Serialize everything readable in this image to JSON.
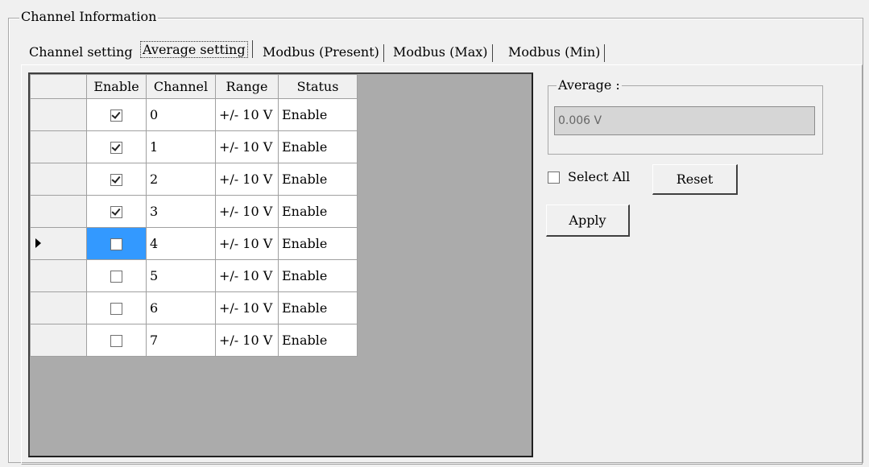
{
  "group_title": "Channel Information",
  "tabs": [
    {
      "label": "Channel setting",
      "active": false
    },
    {
      "label": "Average setting",
      "active": true
    },
    {
      "label": "Modbus (Present)",
      "active": false
    },
    {
      "label": "Modbus (Max)",
      "active": false
    },
    {
      "label": "Modbus (Min)",
      "active": false
    }
  ],
  "grid": {
    "columns": [
      "Enable",
      "Channel",
      "Range",
      "Status"
    ],
    "rows": [
      {
        "enabled": true,
        "channel": "0",
        "range": "+/- 10 V",
        "status": "Enable"
      },
      {
        "enabled": true,
        "channel": "1",
        "range": "+/- 10 V",
        "status": "Enable"
      },
      {
        "enabled": true,
        "channel": "2",
        "range": "+/- 10 V",
        "status": "Enable"
      },
      {
        "enabled": true,
        "channel": "3",
        "range": "+/- 10 V",
        "status": "Enable"
      },
      {
        "enabled": false,
        "channel": "4",
        "range": "+/- 10 V",
        "status": "Enable",
        "current": true
      },
      {
        "enabled": false,
        "channel": "5",
        "range": "+/- 10 V",
        "status": "Enable"
      },
      {
        "enabled": false,
        "channel": "6",
        "range": "+/- 10 V",
        "status": "Enable"
      },
      {
        "enabled": false,
        "channel": "7",
        "range": "+/- 10 V",
        "status": "Enable"
      }
    ]
  },
  "average": {
    "title": "Average :",
    "value": "0.006 V"
  },
  "select_all_label": "Select All",
  "select_all_checked": false,
  "reset_label": "Reset",
  "apply_label": "Apply"
}
